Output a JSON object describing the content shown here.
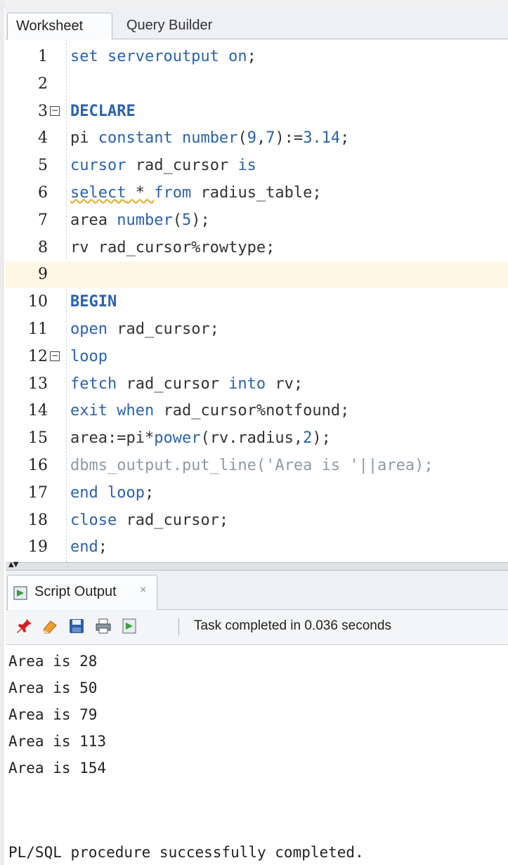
{
  "tabs": {
    "active": "Worksheet",
    "inactive": "Query Builder"
  },
  "editor": {
    "lines": [
      {
        "n": "1",
        "segments": [
          {
            "t": "set serveroutput on",
            "c": "kw"
          },
          {
            "t": ";",
            "c": ""
          }
        ]
      },
      {
        "n": "2",
        "segments": []
      },
      {
        "n": "3",
        "fold": true,
        "segments": [
          {
            "t": "DECLARE",
            "c": "kwb"
          }
        ]
      },
      {
        "n": "4",
        "segments": [
          {
            "t": "pi ",
            "c": ""
          },
          {
            "t": "constant number",
            "c": "kw"
          },
          {
            "t": "(",
            "c": ""
          },
          {
            "t": "9",
            "c": "num"
          },
          {
            "t": ",",
            "c": ""
          },
          {
            "t": "7",
            "c": "num"
          },
          {
            "t": "):=",
            "c": ""
          },
          {
            "t": "3.14",
            "c": "num"
          },
          {
            "t": ";",
            "c": ""
          }
        ]
      },
      {
        "n": "5",
        "segments": [
          {
            "t": "cursor",
            "c": "kw"
          },
          {
            "t": " rad_cursor ",
            "c": ""
          },
          {
            "t": "is",
            "c": "kw"
          }
        ]
      },
      {
        "n": "6",
        "segments": [
          {
            "t": "select",
            "c": "kw sq"
          },
          {
            "t": " * ",
            "c": "sq"
          },
          {
            "t": "from",
            "c": "kw"
          },
          {
            "t": " radius_table;",
            "c": ""
          }
        ]
      },
      {
        "n": "7",
        "segments": [
          {
            "t": "area ",
            "c": ""
          },
          {
            "t": "number",
            "c": "kw"
          },
          {
            "t": "(",
            "c": ""
          },
          {
            "t": "5",
            "c": "num"
          },
          {
            "t": ");",
            "c": ""
          }
        ]
      },
      {
        "n": "8",
        "segments": [
          {
            "t": "rv rad_cursor%rowtype;",
            "c": ""
          }
        ]
      },
      {
        "n": "9",
        "highlight": true,
        "segments": []
      },
      {
        "n": "10",
        "segments": [
          {
            "t": "BEGIN",
            "c": "kwb"
          }
        ]
      },
      {
        "n": "11",
        "segments": [
          {
            "t": "open",
            "c": "kw"
          },
          {
            "t": " rad_cursor;",
            "c": ""
          }
        ]
      },
      {
        "n": "12",
        "fold": true,
        "segments": [
          {
            "t": "loop",
            "c": "kw"
          }
        ]
      },
      {
        "n": "13",
        "segments": [
          {
            "t": "fetch",
            "c": "kw"
          },
          {
            "t": " rad_cursor ",
            "c": ""
          },
          {
            "t": "into",
            "c": "kw"
          },
          {
            "t": " rv;",
            "c": ""
          }
        ]
      },
      {
        "n": "14",
        "segments": [
          {
            "t": "exit when",
            "c": "kw"
          },
          {
            "t": " rad_cursor%notfound;",
            "c": ""
          }
        ]
      },
      {
        "n": "15",
        "segments": [
          {
            "t": "area:=pi*",
            "c": ""
          },
          {
            "t": "power",
            "c": "kw"
          },
          {
            "t": "(rv.radius,",
            "c": ""
          },
          {
            "t": "2",
            "c": "num"
          },
          {
            "t": ");",
            "c": ""
          }
        ]
      },
      {
        "n": "16",
        "segments": [
          {
            "t": "dbms_output.put_line('Area is '||area);",
            "c": "muted"
          }
        ]
      },
      {
        "n": "17",
        "segments": [
          {
            "t": "end loop",
            "c": "kw"
          },
          {
            "t": ";",
            "c": ""
          }
        ]
      },
      {
        "n": "18",
        "segments": [
          {
            "t": "close",
            "c": "kw"
          },
          {
            "t": " rad_cursor;",
            "c": ""
          }
        ]
      },
      {
        "n": "19",
        "segments": [
          {
            "t": "end",
            "c": "kw"
          },
          {
            "t": ";",
            "c": ""
          }
        ]
      }
    ]
  },
  "output_panel": {
    "tab_label": "Script Output",
    "close_glyph": "×",
    "status": "Task completed in 0.036 seconds",
    "toolbar_icons": [
      "pin-icon",
      "eraser-icon",
      "save-icon",
      "print-icon",
      "export-icon"
    ],
    "lines": [
      "Area is 28",
      "Area is 50",
      "Area is 79",
      "Area is 113",
      "Area is 154"
    ],
    "final_message": "PL/SQL procedure successfully completed."
  }
}
